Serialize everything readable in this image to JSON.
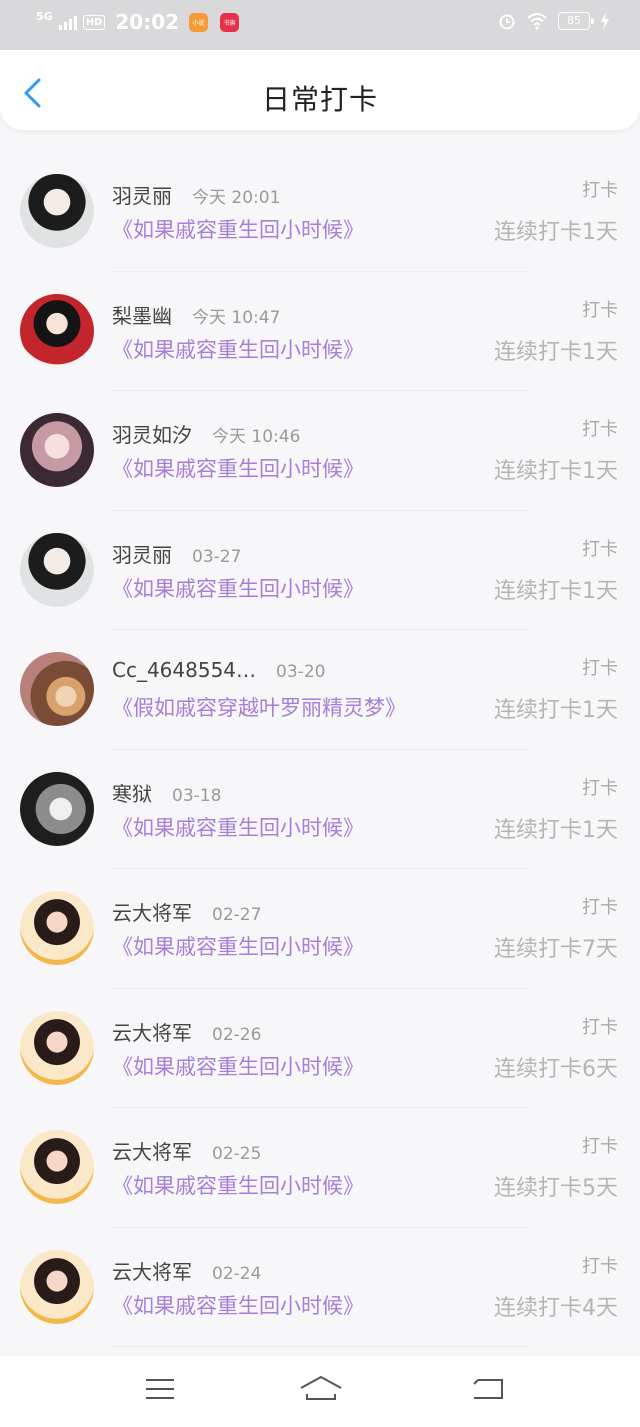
{
  "status": {
    "network": "5G",
    "hd": "HD",
    "time": "20:02",
    "battery": "85",
    "app_badges": [
      {
        "text": "小说",
        "color": "#f29b38"
      },
      {
        "text": "书旗",
        "color": "#e8304a"
      }
    ]
  },
  "header": {
    "title": "日常打卡"
  },
  "items": [
    {
      "name": "羽灵丽",
      "date": "今天 20:01",
      "book": "《如果戚容重生回小时候》",
      "tag": "打卡",
      "streak": "连续打卡1天",
      "avatar": "a1"
    },
    {
      "name": "梨墨幽",
      "date": "今天 10:47",
      "book": "《如果戚容重生回小时候》",
      "tag": "打卡",
      "streak": "连续打卡1天",
      "avatar": "a2"
    },
    {
      "name": "羽灵如汐",
      "date": "今天 10:46",
      "book": "《如果戚容重生回小时候》",
      "tag": "打卡",
      "streak": "连续打卡1天",
      "avatar": "a3"
    },
    {
      "name": "羽灵丽",
      "date": "03-27",
      "book": "《如果戚容重生回小时候》",
      "tag": "打卡",
      "streak": "连续打卡1天",
      "avatar": "a1"
    },
    {
      "name": "Cc_4648554…",
      "date": "03-20",
      "book": "《假如戚容穿越叶罗丽精灵梦》",
      "tag": "打卡",
      "streak": "连续打卡1天",
      "avatar": "a4"
    },
    {
      "name": "寒狱",
      "date": "03-18",
      "book": "《如果戚容重生回小时候》",
      "tag": "打卡",
      "streak": "连续打卡1天",
      "avatar": "a5"
    },
    {
      "name": "云大将军",
      "date": "02-27",
      "book": "《如果戚容重生回小时候》",
      "tag": "打卡",
      "streak": "连续打卡7天",
      "avatar": "a6"
    },
    {
      "name": "云大将军",
      "date": "02-26",
      "book": "《如果戚容重生回小时候》",
      "tag": "打卡",
      "streak": "连续打卡6天",
      "avatar": "a6"
    },
    {
      "name": "云大将军",
      "date": "02-25",
      "book": "《如果戚容重生回小时候》",
      "tag": "打卡",
      "streak": "连续打卡5天",
      "avatar": "a6"
    },
    {
      "name": "云大将军",
      "date": "02-24",
      "book": "《如果戚容重生回小时候》",
      "tag": "打卡",
      "streak": "连续打卡4天",
      "avatar": "a6"
    }
  ],
  "icons": {
    "back": "back-arrow-icon",
    "menu": "menu-icon",
    "home": "home-icon",
    "return": "return-icon"
  },
  "colors": {
    "accent": "#2e9cf4",
    "book_title": "#a77fd6"
  }
}
